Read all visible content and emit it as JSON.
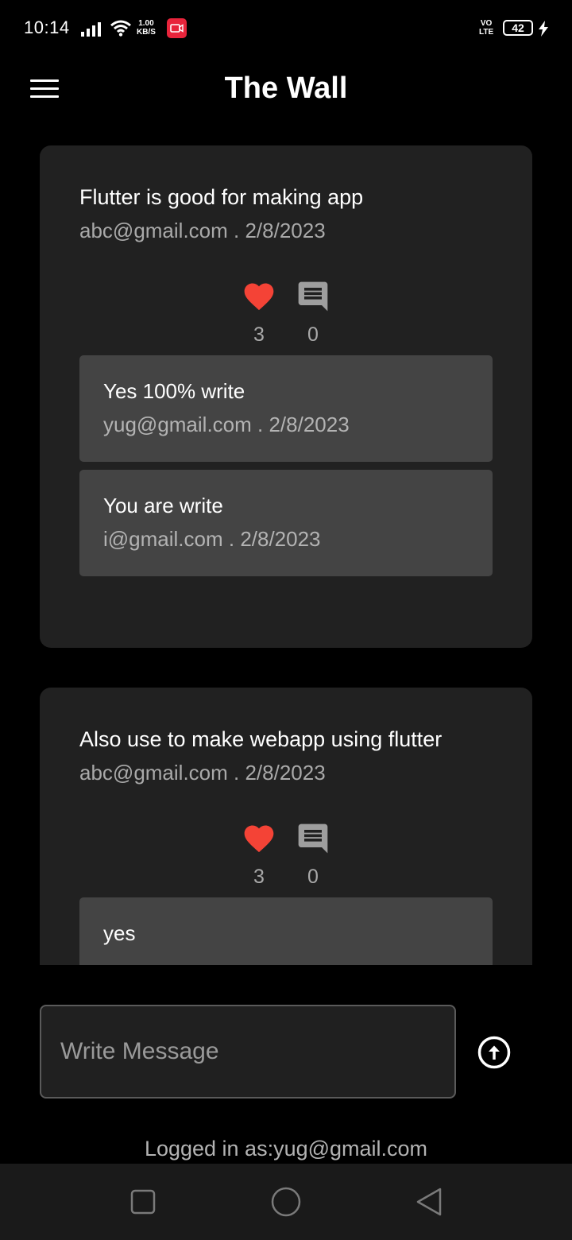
{
  "status_bar": {
    "time": "10:14",
    "speed_value": "1.00",
    "speed_unit": "KB/S",
    "volte_top": "VO",
    "volte_bottom": "LTE",
    "battery": "42",
    "icons": [
      "signal-icon",
      "wifi-icon",
      "screen-record-icon",
      "charging-icon"
    ],
    "record_color": "#e8243b"
  },
  "app_bar": {
    "title": "The Wall",
    "menu_icon": "hamburger-menu-icon"
  },
  "posts": [
    {
      "message": "Flutter is good for making app",
      "meta": "abc@gmail.com . 2/8/2023",
      "likes": "3",
      "comments_count": "0",
      "comments": [
        {
          "text": "Yes 100% write",
          "meta": "yug@gmail.com . 2/8/2023"
        },
        {
          "text": "You are write",
          "meta": "i@gmail.com . 2/8/2023"
        }
      ]
    },
    {
      "message": "Also use to make webapp using flutter",
      "meta": "abc@gmail.com . 2/8/2023",
      "likes": "3",
      "comments_count": "0",
      "comments": [
        {
          "text": "yes",
          "meta": ""
        }
      ]
    }
  ],
  "composer": {
    "placeholder": "Write Message",
    "send_icon": "arrow-up-circle-icon"
  },
  "footer": {
    "logged_in": "Logged in as:yug@gmail.com"
  },
  "navigation": {
    "buttons": [
      "recent-apps-icon",
      "home-icon",
      "back-icon"
    ]
  },
  "colors": {
    "background": "#000000",
    "card": "#212121",
    "comment": "#444444",
    "like": "#f44336",
    "muted_text": "#a9a9a9"
  }
}
